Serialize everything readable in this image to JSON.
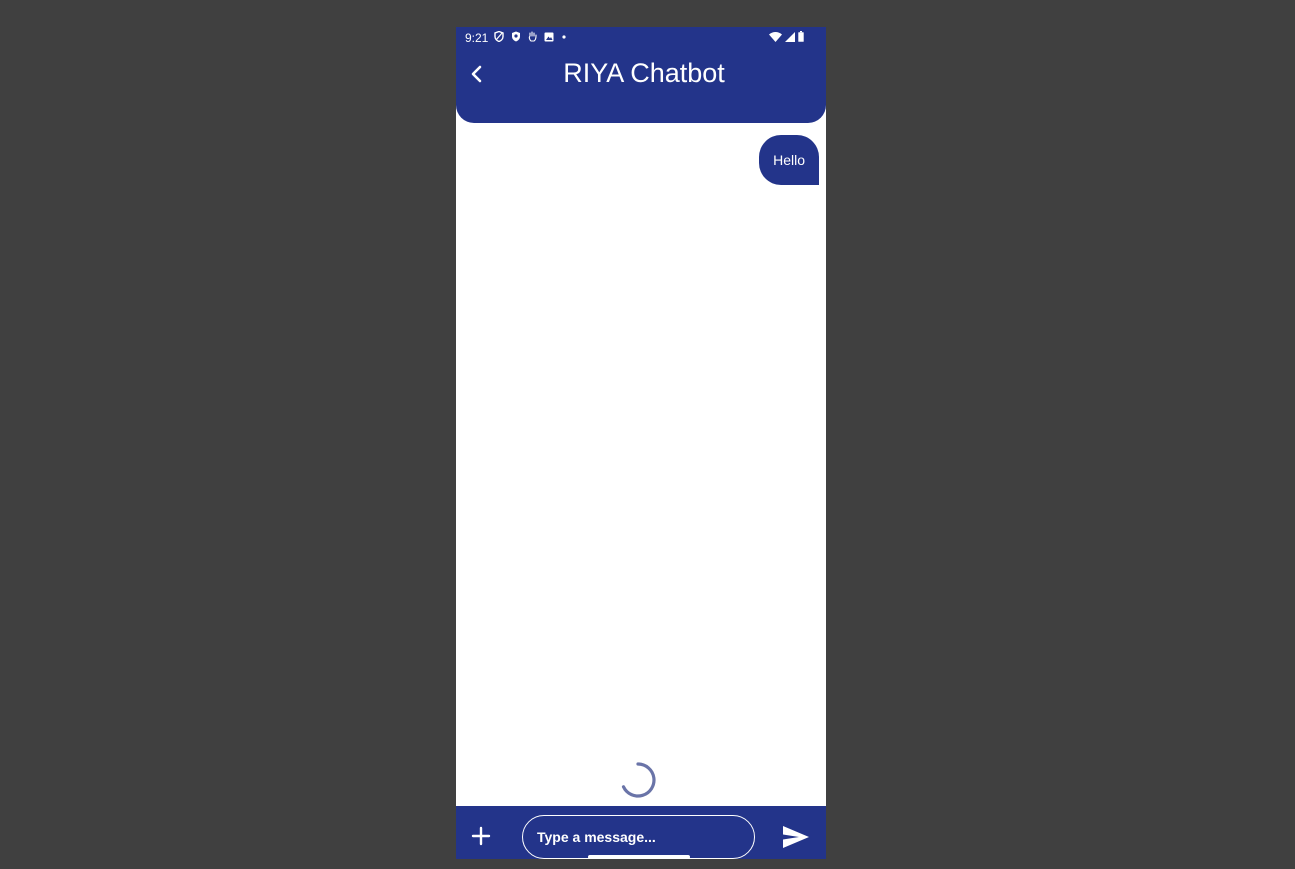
{
  "status_bar": {
    "time": "9:21",
    "left_icons": [
      "vpn-shield-icon",
      "security-shield-icon",
      "hand-icon",
      "media-icon",
      "dot-icon"
    ],
    "right_icons": [
      "wifi-icon",
      "cell-signal-icon",
      "battery-icon"
    ]
  },
  "header": {
    "title": "RIYA Chatbot",
    "back_icon": "chevron-left-icon"
  },
  "messages": [
    {
      "sender": "user",
      "text": "Hello"
    }
  ],
  "loading": true,
  "composer": {
    "placeholder": "Type a message...",
    "value": "",
    "attach_icon": "plus-icon",
    "send_icon": "send-icon"
  },
  "colors": {
    "brand": "#23348a",
    "background": "#ffffff",
    "spinner": "#6a74a8",
    "desktop": "#404040"
  }
}
